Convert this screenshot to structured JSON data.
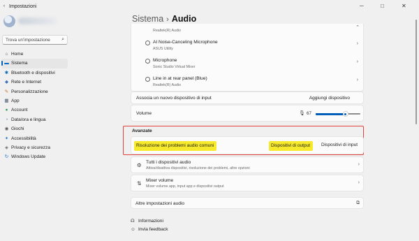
{
  "window": {
    "title": "Impostazioni",
    "minimize": "─",
    "maximize": "□",
    "close": "✕"
  },
  "sidebar": {
    "search_placeholder": "Trova un'impostazione",
    "items": [
      {
        "label": "Home",
        "icon": "⌂",
        "icon_color": "#555555"
      },
      {
        "label": "Sistema",
        "icon": "▬",
        "icon_color": "#0067c0",
        "active": true
      },
      {
        "label": "Bluetooth e dispositivi",
        "icon": "✱",
        "icon_color": "#0067c0"
      },
      {
        "label": "Rete e Internet",
        "icon": "◆",
        "icon_color": "#3b6fb6"
      },
      {
        "label": "Personalizzazione",
        "icon": "✎",
        "icon_color": "#c07020"
      },
      {
        "label": "App",
        "icon": "▦",
        "icon_color": "#4a5a70"
      },
      {
        "label": "Account",
        "icon": "●",
        "icon_color": "#2e9a5a"
      },
      {
        "label": "Data/ora e lingua",
        "icon": "◔",
        "icon_color": "#2f6ab0"
      },
      {
        "label": "Giochi",
        "icon": "◉",
        "icon_color": "#5a5a5a"
      },
      {
        "label": "Accessibilità",
        "icon": "✦",
        "icon_color": "#1f76c8"
      },
      {
        "label": "Privacy e sicurezza",
        "icon": "◈",
        "icon_color": "#6a6a6a"
      },
      {
        "label": "Windows Update",
        "icon": "↻",
        "icon_color": "#1f76c8"
      }
    ]
  },
  "header": {
    "parent": "Sistema",
    "separator": "›",
    "current": "Audio"
  },
  "devices": {
    "top_sub": "Realtek(R) Audio",
    "items": [
      {
        "name": "AI Noise-Canceling Microphone",
        "sub": "ASUS Utility"
      },
      {
        "name": "Microphone",
        "sub": "Sonic Studio Virtual Mixer"
      },
      {
        "name": "Line in at rear panel (Blue)",
        "sub": "Realtek(R) Audio"
      }
    ]
  },
  "associate": {
    "label": "Associa un nuovo dispositivo di input",
    "button": "Aggiungi dispositivo"
  },
  "volume": {
    "label": "Volume",
    "value": "67",
    "level": 0.67
  },
  "advanced": {
    "title": "Avanzate",
    "troubleshoot": "Risoluzione dei problemi audio comuni",
    "output_devices": "Dispositivi di output",
    "input_devices": "Dispositivi di input",
    "highlight_color": "#f7ea2c",
    "box_color": "#e1413b"
  },
  "options": [
    {
      "icon": "⚙",
      "name": "Tutti i dispositivi audio",
      "sub": "Attiva/disattiva dispositivi, risoluzione dei problemi, altre opzioni"
    },
    {
      "icon": "⇅",
      "name": "Mixer volume",
      "sub": "Mixer volume app, input app e dispositivi output"
    }
  ],
  "more_settings": {
    "label": "Altre impostazioni audio",
    "icon": "⧉"
  },
  "links": [
    {
      "label": "Informazioni",
      "icon": "☊"
    },
    {
      "label": "Invia feedback",
      "icon": "☺"
    }
  ],
  "accent_color": "#005fb8"
}
